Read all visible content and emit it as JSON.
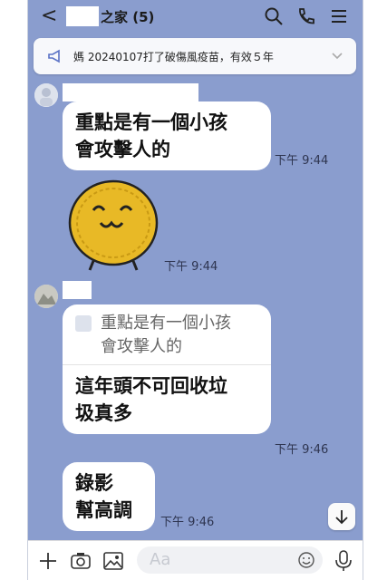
{
  "header": {
    "title": "之家 (5)",
    "icons": [
      "back-icon",
      "search-icon",
      "phone-icon",
      "menu-icon"
    ]
  },
  "announcement": {
    "text": "媽 20240107打了破傷風疫苗，有效５年",
    "icons": [
      "megaphone-icon",
      "chevron-down-icon"
    ]
  },
  "messages": [
    {
      "lines": [
        "重點是有一個小孩",
        "會攻擊人的"
      ],
      "time": "下午 9:44"
    },
    {
      "sticker": "sticker-coin-face",
      "time": "下午 9:44"
    },
    {
      "quoted": [
        "重點是有一個小孩",
        "會攻擊人的"
      ],
      "lines": [
        "這年頭不可回收垃",
        "圾真多"
      ],
      "time": "下午 9:46"
    },
    {
      "lines": [
        "錄影",
        "幫高調"
      ],
      "time": "下午 9:46"
    }
  ],
  "composer": {
    "placeholder": "Aa",
    "icons": [
      "plus-icon",
      "camera-icon",
      "image-icon",
      "emoji-icon",
      "mic-icon"
    ]
  },
  "colors": {
    "chat_bg": "#8a9dce",
    "bubble": "#ffffff",
    "sticker": "#e8b926"
  }
}
